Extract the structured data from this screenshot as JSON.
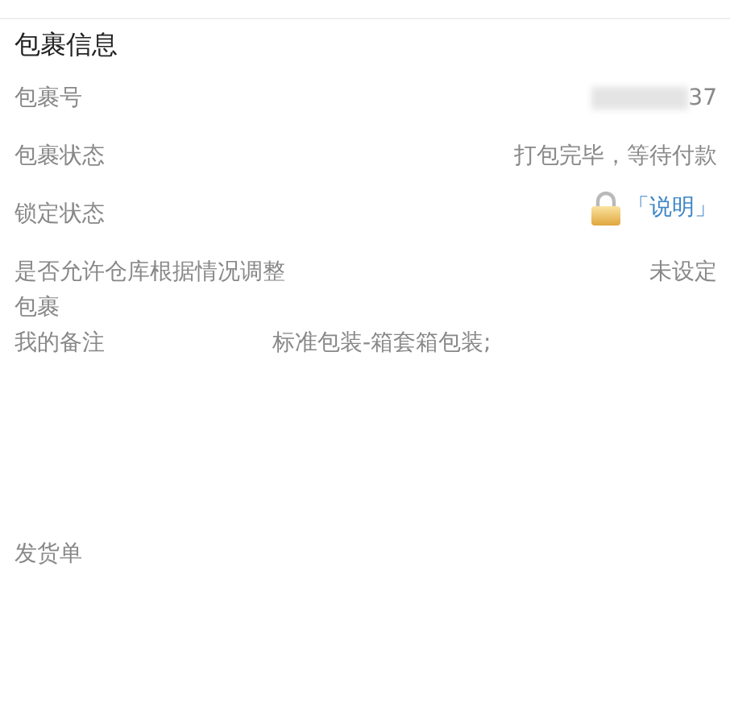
{
  "section_title": "包裹信息",
  "rows": [
    {
      "kind": "redacted",
      "label": "包裹号",
      "value": "37"
    },
    {
      "kind": "text",
      "label": "包裹状态",
      "value": "打包完毕，等待付款"
    },
    {
      "kind": "lock",
      "label": "锁定状态",
      "link": "「说明」"
    },
    {
      "kind": "text",
      "label": "是否允许仓库根据情况调整包裹",
      "value": "未设定"
    },
    {
      "kind": "note",
      "label": "我的备注",
      "value": "标准包装-箱套箱包装;"
    }
  ],
  "footer_label": "发货单"
}
